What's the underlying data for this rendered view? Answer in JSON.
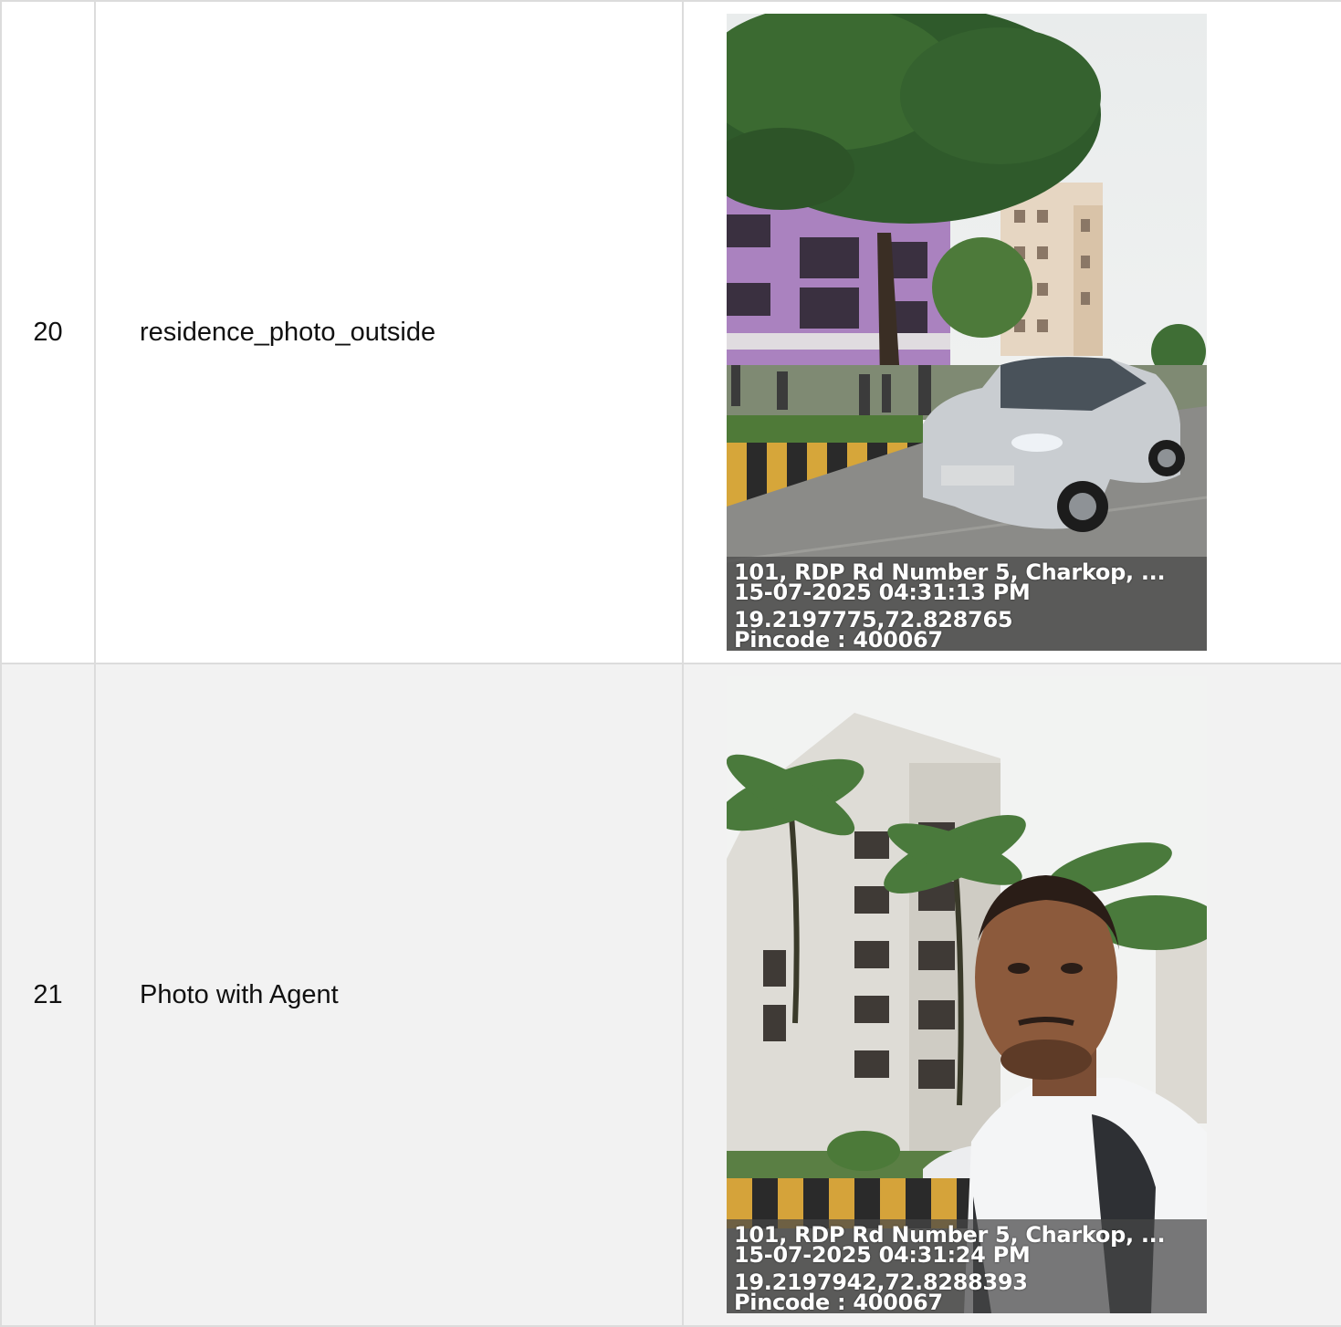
{
  "rows": [
    {
      "number": "20",
      "label": "residence_photo_outside",
      "photo": {
        "description": "street view of residential buildings with a silver car",
        "stamp": {
          "address": "101, RDP Rd Number 5, Charkop, ...",
          "datetime": "15-07-2025 04:31:13 PM",
          "coords": "19.2197775,72.828765",
          "pincode": "Pincode : 400067"
        }
      }
    },
    {
      "number": "21",
      "label": "Photo with Agent",
      "photo": {
        "description": "selfie of agent in front of apartment building with palm trees",
        "stamp": {
          "address": "101, RDP Rd Number 5, Charkop, ...",
          "datetime": "15-07-2025 04:31:24 PM",
          "coords": "19.2197942,72.8288393",
          "pincode": "Pincode : 400067"
        }
      }
    }
  ],
  "colors": {
    "border": "#dcdcdc",
    "row_alt_bg": "#f2f2f2",
    "stamp_bg": "#464646"
  }
}
